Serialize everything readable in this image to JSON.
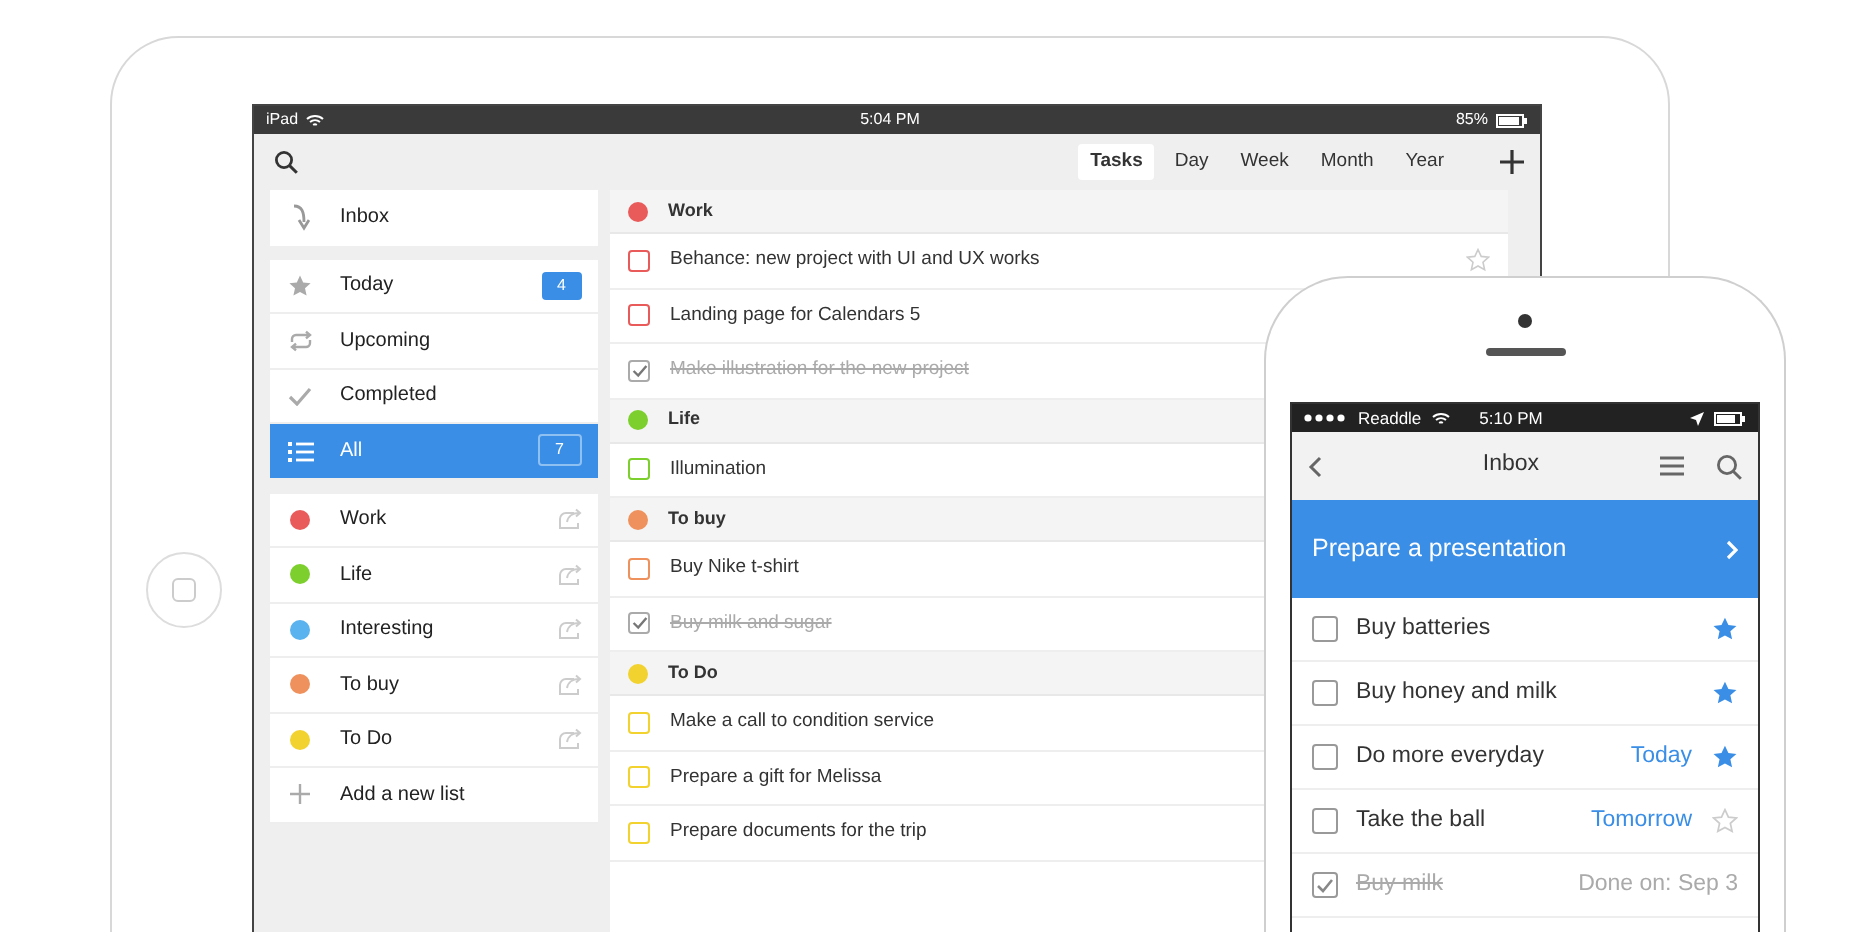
{
  "ipad": {
    "status_bar": {
      "carrier": "iPad",
      "time": "5:04 PM",
      "battery": "85%"
    },
    "view_tabs": [
      {
        "label": "Tasks",
        "selected": true
      },
      {
        "label": "Day",
        "selected": false
      },
      {
        "label": "Week",
        "selected": false
      },
      {
        "label": "Month",
        "selected": false
      },
      {
        "label": "Year",
        "selected": false
      }
    ],
    "sidebar": {
      "inbox": "Inbox",
      "filters": [
        {
          "kind": "today",
          "label": "Today",
          "badge": "4",
          "selected": false
        },
        {
          "kind": "upcoming",
          "label": "Upcoming",
          "selected": false
        },
        {
          "kind": "completed",
          "label": "Completed",
          "selected": false
        },
        {
          "kind": "all",
          "label": "All",
          "badge": "7",
          "selected": true
        }
      ],
      "lists": [
        {
          "label": "Work",
          "color": "#e95b5b"
        },
        {
          "label": "Life",
          "color": "#7ccf2c"
        },
        {
          "label": "Interesting",
          "color": "#5ab2ee"
        },
        {
          "label": "To buy",
          "color": "#ef915c"
        },
        {
          "label": "To Do",
          "color": "#f2d22e"
        }
      ],
      "add_list": "Add a new list"
    },
    "tasks": {
      "groups": [
        {
          "name": "Work",
          "color": "#e95b5b",
          "tasks": [
            {
              "title": "Behance: new project with UI and UX works",
              "checked": false,
              "starred": false
            },
            {
              "title": "Landing page for Calendars 5",
              "checked": false
            },
            {
              "title": "Make illustration for the new project",
              "checked": true
            }
          ]
        },
        {
          "name": "Life",
          "color": "#7ccf2c",
          "tasks": [
            {
              "title": "Illumination",
              "checked": false
            }
          ]
        },
        {
          "name": "To buy",
          "color": "#ef915c",
          "tasks": [
            {
              "title": "Buy Nike t-shirt",
              "checked": false
            },
            {
              "title": "Buy milk and sugar",
              "checked": true
            }
          ]
        },
        {
          "name": "To Do",
          "color": "#f2d22e",
          "tasks": [
            {
              "title": "Make a call to condition service",
              "checked": false
            },
            {
              "title": "Prepare a gift for Melissa",
              "checked": false
            },
            {
              "title": "Prepare documents for the trip",
              "checked": false
            }
          ]
        }
      ]
    }
  },
  "iphone": {
    "status_bar": {
      "carrier": "Readdle",
      "time": "5:10 PM"
    },
    "title": "Inbox",
    "new_task": {
      "value": "Prepare a presentation"
    },
    "tasks": [
      {
        "title": "Buy batteries",
        "checked": false,
        "starred": true
      },
      {
        "title": "Buy honey and milk",
        "checked": false,
        "starred": true
      },
      {
        "title": "Do more everyday",
        "checked": false,
        "due": "Today",
        "starred": true
      },
      {
        "title": "Take the ball",
        "checked": false,
        "due": "Tomorrow",
        "starred": false
      },
      {
        "title": "Buy milk",
        "checked": true,
        "due": "Done on: Sep 3"
      }
    ]
  }
}
